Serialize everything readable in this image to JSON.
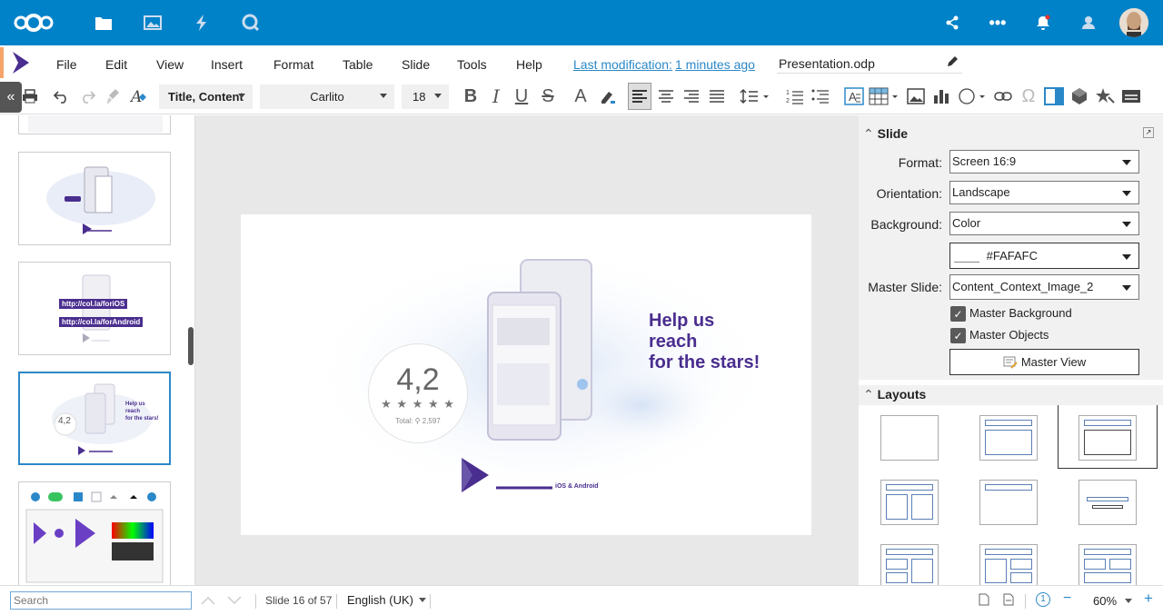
{
  "topbar": {
    "apps": [
      "files-icon",
      "photos-icon",
      "activity-icon",
      "search-icon"
    ],
    "right": [
      "share-icon",
      "more-icon",
      "notifications-icon",
      "contacts-icon",
      "avatar"
    ]
  },
  "menubar": {
    "items": [
      "File",
      "Edit",
      "View",
      "Insert",
      "Format",
      "Table",
      "Slide",
      "Tools",
      "Help"
    ],
    "last_mod_label": "Last modification:",
    "last_mod_value": "1 minutes ago",
    "filename": "Presentation.odp"
  },
  "toolbar": {
    "style": "Title, Content",
    "font": "Carlito",
    "size": "18"
  },
  "thumbs": {
    "t3_url1": "http://col.la/foriOS",
    "t3_url2": "http://col.la/forAndroid",
    "t4_rating": "4,2",
    "t4_text": [
      "Help us",
      "reach",
      "for the stars!"
    ]
  },
  "slide": {
    "rating": "4,2",
    "stars": "★ ★ ★ ★ ★",
    "rating_value": 4.2,
    "total_label": "Total:",
    "total_value": "2,597",
    "heading": [
      "Help us",
      "reach",
      "for the stars!"
    ],
    "platform": "iOS & Android",
    "brand_color": "#4a2e8f"
  },
  "sidebar": {
    "slide_header": "Slide",
    "format_label": "Format:",
    "format_value": "Screen 16:9",
    "orientation_label": "Orientation:",
    "orientation_value": "Landscape",
    "background_label": "Background:",
    "background_value": "Color",
    "color_value": "#FAFAFC",
    "master_label": "Master Slide:",
    "master_value": "Content_Context_Image_2",
    "master_bg": "Master Background",
    "master_obj": "Master Objects",
    "master_view": "Master View",
    "layouts_header": "Layouts"
  },
  "status": {
    "search_placeholder": "Search",
    "slide_info": "Slide 16 of 57",
    "language": "English (UK)",
    "zoom": "60%"
  }
}
